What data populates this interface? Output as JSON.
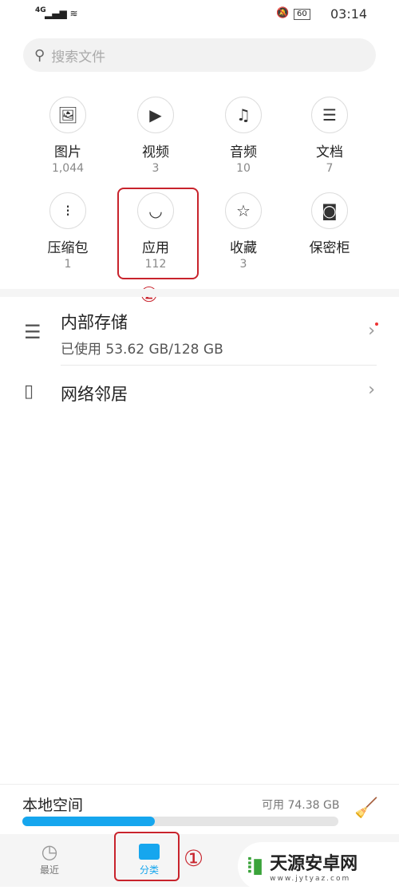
{
  "status": {
    "network": "4G",
    "battery": "60",
    "time": "03:14"
  },
  "search": {
    "placeholder": "搜索文件"
  },
  "categories": [
    {
      "label": "图片",
      "count": "1,044",
      "icon": "image-icon",
      "glyph": "🖼"
    },
    {
      "label": "视频",
      "count": "3",
      "icon": "video-icon",
      "glyph": "▶"
    },
    {
      "label": "音频",
      "count": "10",
      "icon": "audio-icon",
      "glyph": "♫"
    },
    {
      "label": "文档",
      "count": "7",
      "icon": "document-icon",
      "glyph": "☰"
    },
    {
      "label": "压缩包",
      "count": "1",
      "icon": "archive-icon",
      "glyph": "⁝"
    },
    {
      "label": "应用",
      "count": "112",
      "icon": "app-bag-icon",
      "glyph": "◡"
    },
    {
      "label": "收藏",
      "count": "3",
      "icon": "star-folder-icon",
      "glyph": "☆"
    },
    {
      "label": "保密柜",
      "count": "",
      "icon": "safe-icon",
      "glyph": "◙"
    }
  ],
  "annotations": {
    "one": "①",
    "two": "②"
  },
  "storage": {
    "title": "内部存储",
    "usage": "已使用 53.62 GB/128 GB"
  },
  "network": {
    "title": "网络邻居"
  },
  "local": {
    "title": "本地空间",
    "available": "可用 74.38 GB",
    "used_percent": 42
  },
  "nav": {
    "recent": "最近",
    "category": "分类"
  },
  "watermark": {
    "text": "天源安卓网",
    "url": "www.jytyaz.com"
  },
  "colors": {
    "accent": "#16a6ee",
    "annotation": "#c8232c"
  }
}
